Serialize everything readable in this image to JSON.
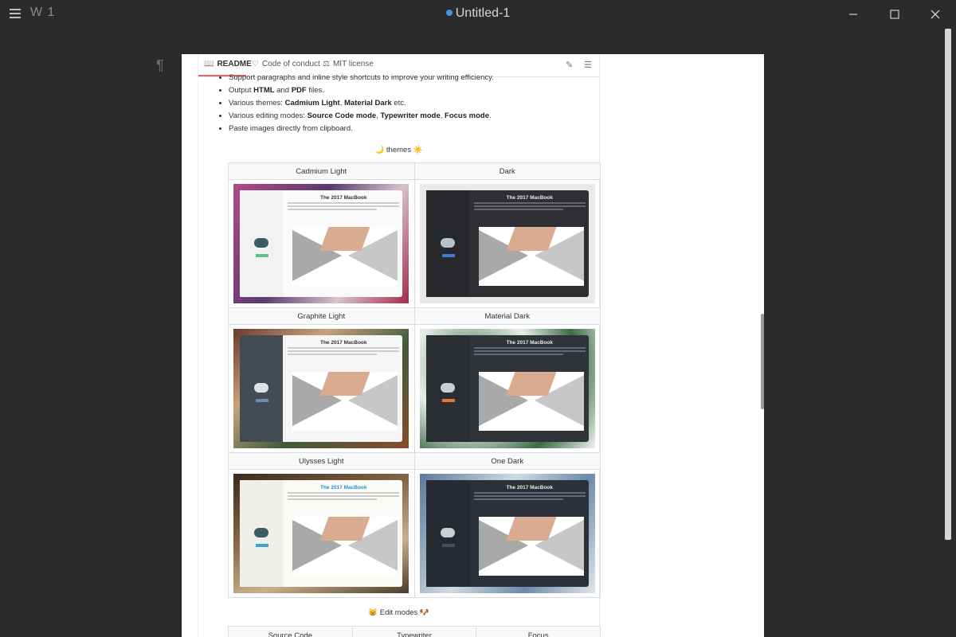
{
  "window": {
    "workspace": "W 1",
    "title": "Untitled-1",
    "accent": "#4a90e2"
  },
  "tabs": [
    {
      "label": "README",
      "icon": "book-icon"
    },
    {
      "label": "Code of conduct",
      "icon": "heart-icon"
    },
    {
      "label": "MIT license",
      "icon": "scale-icon"
    }
  ],
  "features": {
    "item1": "Support paragraphs and inline style shortcuts to improve your writing efficiency.",
    "item2_pre": "Output ",
    "item2_b1": "HTML",
    "item2_mid": " and ",
    "item2_b2": "PDF",
    "item2_post": " files.",
    "item3_pre": "Various themes: ",
    "item3_b1": "Cadmium Light",
    "item3_mid": ", ",
    "item3_b2": "Material Dark",
    "item3_post": " etc.",
    "item4_pre": "Various editing modes: ",
    "item4_b1": "Source Code mode",
    "item4_s1": ", ",
    "item4_b2": "Typewriter mode",
    "item4_s2": ", ",
    "item4_b3": "Focus mode",
    "item4_post": ".",
    "item5": "Paste images directly from clipboard."
  },
  "themes_caption": "🌙 themes ☀️",
  "themes": [
    {
      "name": "Cadmium Light",
      "shot_title": "The 2017 MacBook"
    },
    {
      "name": "Dark",
      "shot_title": "The 2017 MacBook"
    },
    {
      "name": "Graphite Light",
      "shot_title": "The 2017 MacBook"
    },
    {
      "name": "Material Dark",
      "shot_title": "The 2017 MacBook"
    },
    {
      "name": "Ulysses Light",
      "shot_title": "The 2017 MacBook"
    },
    {
      "name": "One Dark",
      "shot_title": "The 2017 MacBook"
    }
  ],
  "modes_caption": "😸 Edit modes 🐶",
  "modes": [
    "Source Code",
    "Typewriter",
    "Focus"
  ]
}
